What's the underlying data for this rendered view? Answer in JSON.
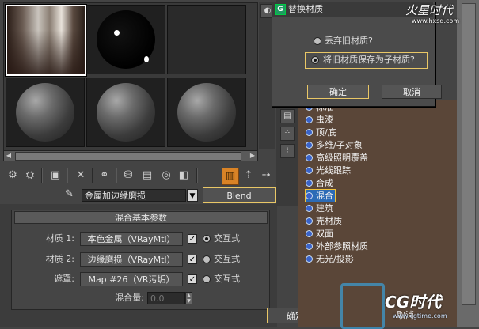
{
  "material": {
    "name": "金属加边缘磨损",
    "type_button": "Blend"
  },
  "rollout": {
    "title": "混合基本参数",
    "collapse_symbol": "−",
    "rows": [
      {
        "label": "材质 1:",
        "map": "本色金属（VRayMtl）",
        "checked": true,
        "radio_on": true,
        "interactive": "交互式"
      },
      {
        "label": "材质 2:",
        "map": "边缘磨损（VRayMtl）",
        "checked": true,
        "radio_on": false,
        "interactive": "交互式"
      },
      {
        "label": "遮罩:",
        "map": "Map #26（VR污垢）",
        "checked": true,
        "radio_on": false,
        "interactive": "交互式"
      }
    ],
    "mix_amount_label": "混合量:",
    "mix_amount_value": "0.0"
  },
  "bottom": {
    "ok": "确定",
    "cancel": "取消"
  },
  "browser": {
    "items": [
      {
        "label": "标准",
        "highlight": false
      },
      {
        "label": "虫漆",
        "highlight": false
      },
      {
        "label": "顶/底",
        "highlight": false
      },
      {
        "label": "多维/子对象",
        "highlight": false
      },
      {
        "label": "高级照明覆盖",
        "highlight": false
      },
      {
        "label": "光线跟踪",
        "highlight": false
      },
      {
        "label": "合成",
        "highlight": false
      },
      {
        "label": "混合",
        "highlight": true
      },
      {
        "label": "建筑",
        "highlight": false
      },
      {
        "label": "壳材质",
        "highlight": false
      },
      {
        "label": "双面",
        "highlight": false
      },
      {
        "label": "外部参照材质",
        "highlight": false
      },
      {
        "label": "无光/投影",
        "highlight": false
      }
    ]
  },
  "dialog": {
    "title": "替换材质",
    "icon_text": "G",
    "option1": "丢弃旧材质?",
    "option2": "将旧材质保存为子材质?",
    "ok": "确定",
    "cancel": "取消"
  },
  "watermark": {
    "top_brand": "火星时代",
    "top_url": "www.hxsd.com",
    "bottom_brand": "CG时代",
    "bottom_url": "www.cgtime.com"
  },
  "colors": {
    "highlight_border": "#e9c766",
    "arrow": "#f0c23a",
    "active_tool": "#d98326",
    "selected_item": "#2c6bb6"
  }
}
